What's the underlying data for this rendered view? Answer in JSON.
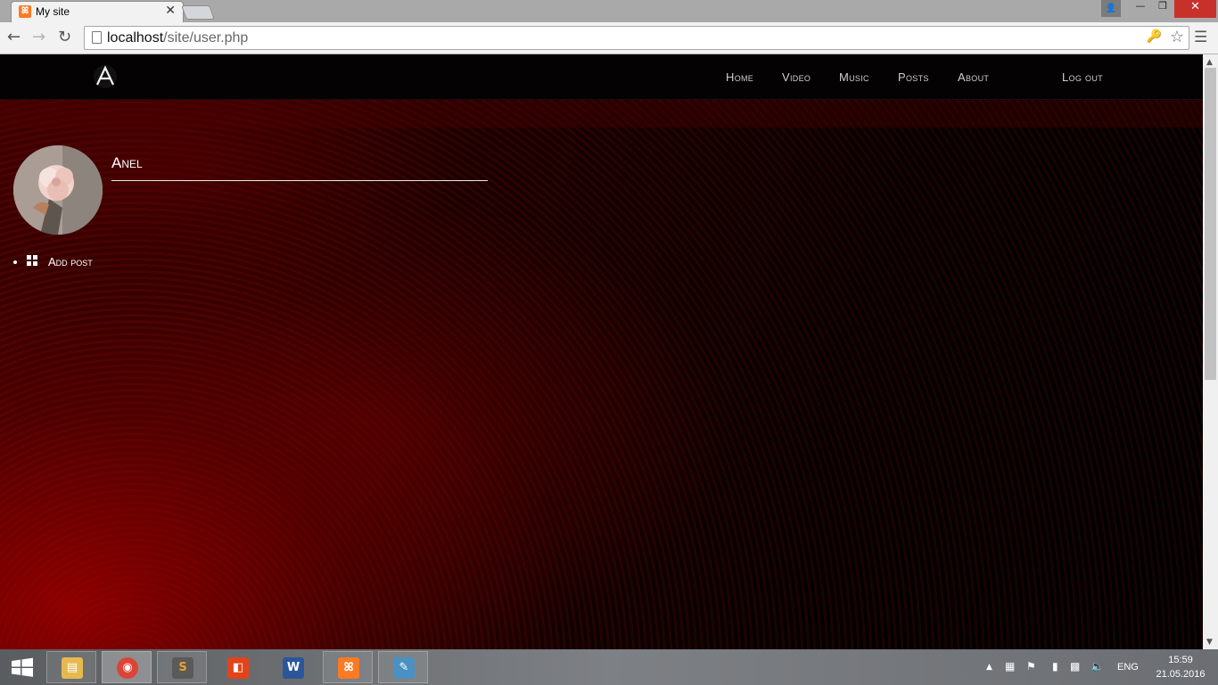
{
  "browser": {
    "tab_title": "My site",
    "favicon_glyph": "ꕤ",
    "close_glyph": "✕",
    "url_host": "localhost",
    "url_path": "/site/user.php",
    "icons": {
      "back": "arrow-left-icon",
      "forward": "arrow-right-icon",
      "reload": "reload-icon",
      "page": "page-icon",
      "key": "key-icon",
      "star": "star-icon",
      "menu": "hamburger-menu-icon"
    }
  },
  "window_controls": {
    "minimize": "—",
    "maximize": "❐",
    "close": "✕"
  },
  "site": {
    "nav": {
      "home": "Home",
      "video": "Video",
      "music": "Music",
      "posts": "Posts",
      "about": "About",
      "logout": "Log out"
    },
    "profile": {
      "username": "Anel"
    },
    "actions": [
      {
        "label": "Add post",
        "icon": "grid-icon"
      }
    ]
  },
  "taskbar": {
    "apps": [
      {
        "name": "file-explorer",
        "glyph": "▤",
        "color": "#e6b94f"
      },
      {
        "name": "chrome",
        "glyph": "◉",
        "color": "#db4437"
      },
      {
        "name": "sublime-text",
        "glyph": "S",
        "color": "#5a5a5a"
      },
      {
        "name": "office",
        "glyph": "◧",
        "color": "#e3431a"
      },
      {
        "name": "word",
        "glyph": "W",
        "color": "#2b579a"
      },
      {
        "name": "xampp",
        "glyph": "ꕤ",
        "color": "#fb7a24"
      },
      {
        "name": "paint",
        "glyph": "✎",
        "color": "#4a90c2"
      }
    ],
    "language": "ENG",
    "time": "15:59",
    "date": "21.05.2016"
  },
  "colors": {
    "accent_red": "#8b0000",
    "header_bg": "#040202",
    "chrome_close": "#c7312a"
  }
}
